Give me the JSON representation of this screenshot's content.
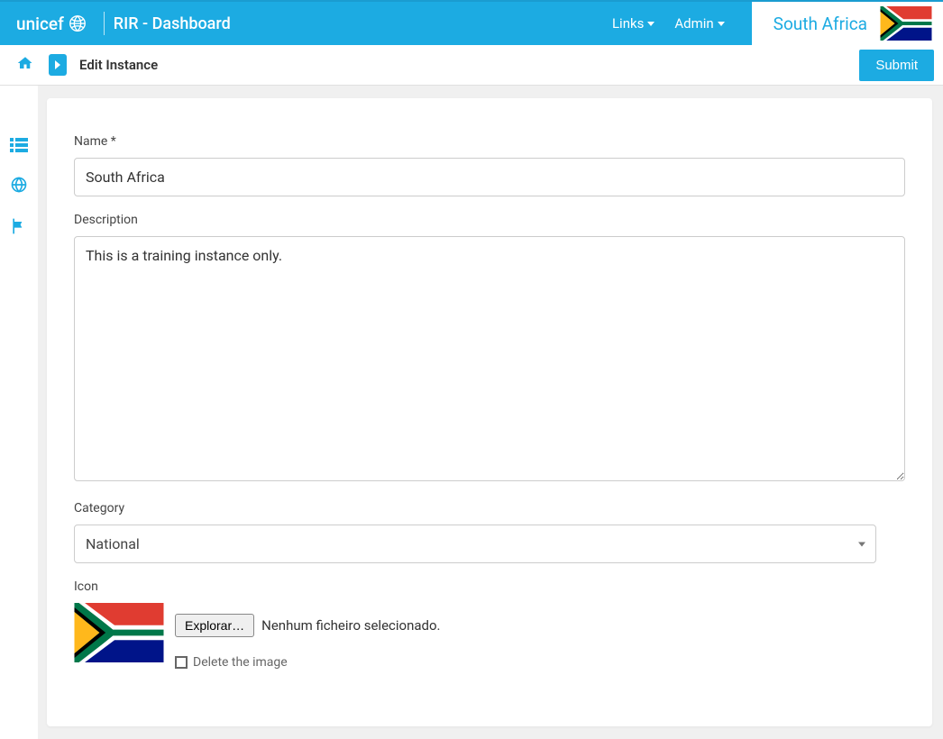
{
  "header": {
    "brand": "unicef",
    "app_title": "RIR - Dashboard",
    "links_label": "Links",
    "admin_label": "Admin",
    "country_name": "South Africa"
  },
  "subheader": {
    "page_title": "Edit Instance",
    "submit_label": "Submit"
  },
  "form": {
    "name_label": "Name *",
    "name_value": "South Africa",
    "description_label": "Description",
    "description_value": "This is a training instance only.",
    "category_label": "Category",
    "category_value": "National",
    "icon_label": "Icon",
    "file_button": "Explorar…",
    "file_status": "Nenhum ficheiro selecionado.",
    "delete_image_label": "Delete the image"
  },
  "icons": {
    "home": "home-icon",
    "expand": "expand-icon",
    "list": "list-icon",
    "globe": "globe-icon",
    "flag": "flag-icon"
  }
}
